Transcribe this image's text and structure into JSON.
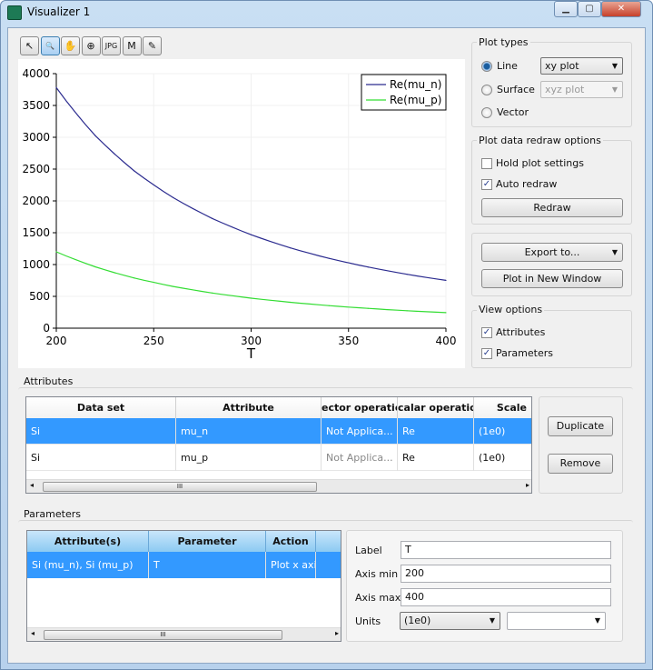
{
  "window": {
    "title": "Visualizer 1",
    "minimize": "▁",
    "maximize": "▢",
    "close": "✕"
  },
  "toolbar": [
    {
      "icon": "pointer-icon",
      "glyph": "↖"
    },
    {
      "icon": "zoom-icon",
      "glyph": "🔍"
    },
    {
      "icon": "pan-hand-icon",
      "glyph": "✋"
    },
    {
      "icon": "zoom-target-icon",
      "glyph": "⊕"
    },
    {
      "icon": "export-jpg-icon",
      "glyph": "JPG"
    },
    {
      "icon": "marker-icon",
      "glyph": "M"
    },
    {
      "icon": "pencil-icon",
      "glyph": "✎"
    }
  ],
  "chart_data": {
    "type": "line",
    "xlabel": "T",
    "ylabel": "",
    "xlim": [
      200,
      400
    ],
    "ylim": [
      0,
      4000
    ],
    "xticks": [
      200,
      250,
      300,
      350,
      400
    ],
    "yticks": [
      0,
      500,
      1000,
      1500,
      2000,
      2500,
      3000,
      3500,
      4000
    ],
    "grid": true,
    "legend": "top-right",
    "x": [
      200,
      220,
      240,
      260,
      280,
      300,
      320,
      340,
      360,
      380,
      400
    ],
    "series": [
      {
        "name": "Re(mu_n)",
        "color": "#2b2b8f",
        "values": [
          3780,
          3026,
          2472,
          2051,
          1725,
          1469,
          1263,
          1097,
          961,
          847,
          751
        ]
      },
      {
        "name": "Re(mu_p)",
        "color": "#33dd33",
        "values": [
          1200,
          964,
          789,
          656,
          553,
          472,
          407,
          354,
          311,
          274,
          244
        ]
      }
    ]
  },
  "plot_types": {
    "title": "Plot types",
    "line": "Line",
    "surface": "Surface",
    "vector": "Vector",
    "line_select": "xy plot",
    "surface_select": "xyz plot",
    "selected": "Line"
  },
  "redraw": {
    "title": "Plot data redraw options",
    "hold": "Hold plot settings",
    "hold_checked": false,
    "auto": "Auto redraw",
    "auto_checked": true,
    "button": "Redraw"
  },
  "export": {
    "export_to": "Export to...",
    "new_window": "Plot in New Window"
  },
  "view": {
    "title": "View options",
    "attributes": "Attributes",
    "parameters": "Parameters",
    "attributes_checked": true,
    "parameters_checked": true
  },
  "attributes": {
    "title": "Attributes",
    "columns": [
      "Data set",
      "Attribute",
      "ector operatio",
      "calar operatio",
      "Scale"
    ],
    "rows": [
      [
        "Si",
        "mu_n",
        "Not Applica...",
        "Re",
        "(1e0)"
      ],
      [
        "Si",
        "mu_p",
        "Not Applica...",
        "Re",
        "(1e0)"
      ]
    ],
    "duplicate": "Duplicate",
    "remove": "Remove",
    "scroll_grip": "III"
  },
  "parameters": {
    "title": "Parameters",
    "columns": [
      "Attribute(s)",
      "Parameter",
      "Action"
    ],
    "rows": [
      [
        "Si (mu_n), Si (mu_p)",
        "T",
        "Plot x axis"
      ]
    ],
    "label_label": "Label",
    "label_value": "T",
    "min_label": "Axis min",
    "min_value": "200",
    "max_label": "Axis max",
    "max_value": "400",
    "units_label": "Units",
    "units_value": "(1e0)",
    "units2_value": "",
    "scroll_grip": "III"
  }
}
